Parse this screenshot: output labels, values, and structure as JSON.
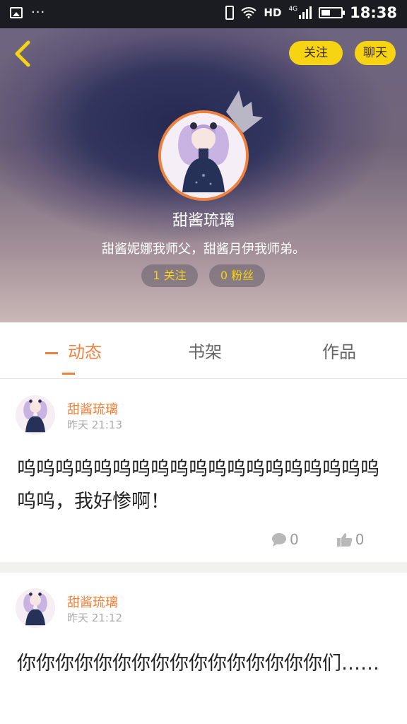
{
  "status_bar": {
    "time": "18:38",
    "network": "HD",
    "network_gen": "4G",
    "dots": "···"
  },
  "header": {
    "follow_label": "关注",
    "chat_label": "聊天",
    "username": "甜酱琉璃",
    "bio": "甜酱妮娜我师父，甜酱月伊我师弟。",
    "following": "1 关注",
    "fans": "0 粉丝"
  },
  "tabs": [
    {
      "label": "动态",
      "active": true
    },
    {
      "label": "书架",
      "active": false
    },
    {
      "label": "作品",
      "active": false
    }
  ],
  "posts": [
    {
      "author": "甜酱琉璃",
      "time": "昨天 21:13",
      "text": "呜呜呜呜呜呜呜呜呜呜呜呜呜呜呜呜呜呜呜呜呜，我好惨啊！",
      "comments": "0",
      "likes": "0"
    },
    {
      "author": "甜酱琉璃",
      "time": "昨天 21:12",
      "text": "你你你你你你你你你你你你你你你你们……"
    }
  ],
  "colors": {
    "accent": "#f0813d",
    "button": "#f6d313",
    "status_bar": "#1b1b22"
  },
  "icons": [
    "back-icon",
    "crown-icon",
    "comment-icon",
    "like-icon"
  ]
}
